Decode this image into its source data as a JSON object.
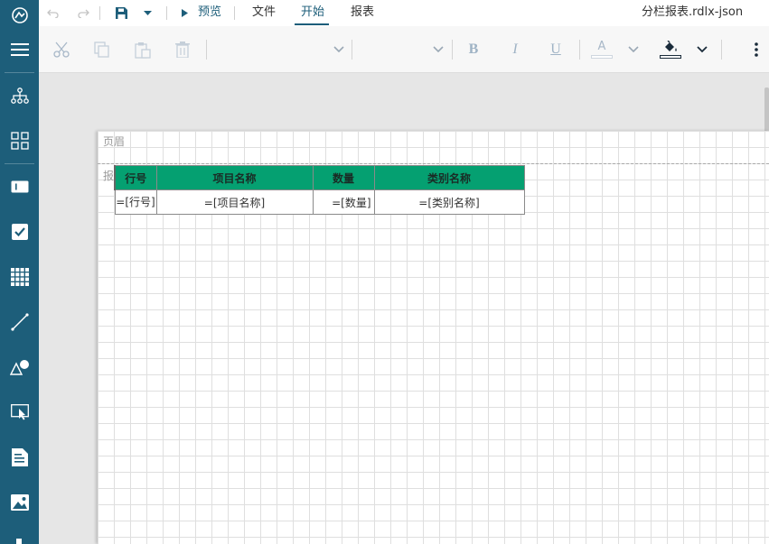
{
  "app": {
    "doc_title": "分栏报表.rdlx-json"
  },
  "menu": {
    "preview_label": "预览",
    "items": [
      {
        "label": "文件"
      },
      {
        "label": "开始"
      },
      {
        "label": "报表"
      }
    ],
    "active_index": 1
  },
  "toolbar": {
    "bold_label": "B",
    "italic_label": "I",
    "underline_label": "U",
    "font_color_label": "A"
  },
  "sidebar": {
    "icons": [
      "app-logo-icon",
      "hamburger-menu-icon",
      "report-explorer-icon",
      "group-editor-icon",
      "textbox-tool-icon",
      "checkbox-tool-icon",
      "table-tool-icon",
      "line-tool-icon",
      "shape-tool-icon",
      "container-tool-icon",
      "list-tool-icon",
      "image-tool-icon"
    ]
  },
  "report": {
    "header_band_label": "页眉",
    "body_band_label": "报",
    "columns": [
      "行号",
      "项目名称",
      "数量",
      "类别名称"
    ],
    "detail": [
      "=[行号]",
      "=[项目名称]",
      "=[数量]",
      "=[类别名称]"
    ]
  },
  "colors": {
    "sidebar": "#1d5e7a",
    "table_header": "#05a071",
    "accent": "#1d5e7a"
  }
}
